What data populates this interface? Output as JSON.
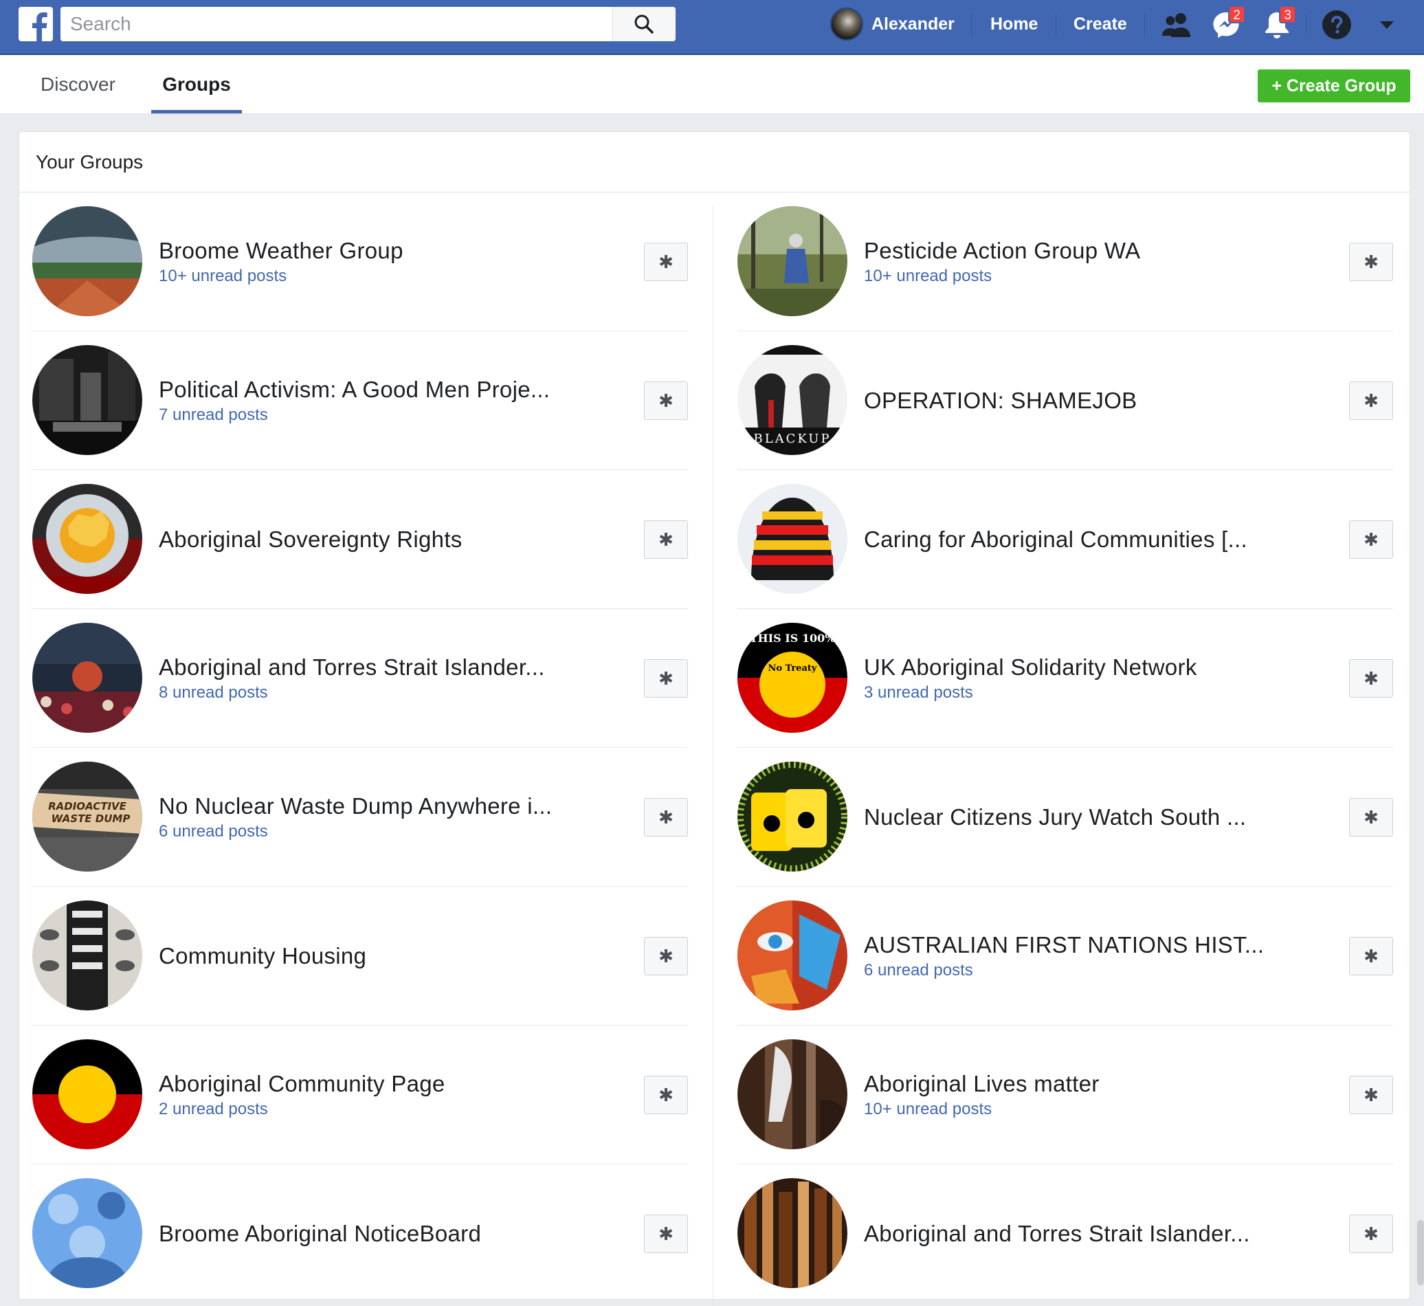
{
  "topbar": {
    "logo_icon": "facebook-f-icon",
    "search": {
      "placeholder": "Search",
      "value": "",
      "icon": "search-icon"
    },
    "profile_name": "Alexander",
    "home_label": "Home",
    "create_label": "Create",
    "friends_icon": "friends-icon",
    "messenger_icon": "messenger-icon",
    "messenger_badge": "2",
    "notifications_icon": "bell-icon",
    "notifications_badge": "3",
    "help_icon": "question-icon",
    "menu_icon": "caret-down-icon",
    "brand_color": "#4267b2",
    "badge_color": "#fa3e3e"
  },
  "subheader": {
    "tabs": [
      {
        "label": "Discover",
        "active": false
      },
      {
        "label": "Groups",
        "active": true
      }
    ],
    "create_group_label": "+ Create Group",
    "create_group_color": "#42b72a"
  },
  "your_groups": {
    "title": "Your Groups",
    "left": [
      {
        "name": "Broome Weather Group",
        "unread": "10+ unread posts"
      },
      {
        "name": "Political Activism: A Good Men Proje...",
        "unread": "7 unread posts"
      },
      {
        "name": "Aboriginal Sovereignty Rights",
        "unread": ""
      },
      {
        "name": "Aboriginal and Torres Strait Islander...",
        "unread": "8 unread posts"
      },
      {
        "name": "No Nuclear Waste Dump Anywhere i...",
        "unread": "6 unread posts"
      },
      {
        "name": "Community Housing",
        "unread": ""
      },
      {
        "name": "Aboriginal Community Page",
        "unread": "2 unread posts"
      },
      {
        "name": "Broome Aboriginal NoticeBoard",
        "unread": ""
      }
    ],
    "right": [
      {
        "name": "Pesticide Action Group WA",
        "unread": "10+ unread posts"
      },
      {
        "name": "OPERATION: SHAMEJOB",
        "unread": ""
      },
      {
        "name": "Caring for Aboriginal Communities [...",
        "unread": ""
      },
      {
        "name": "UK Aboriginal Solidarity Network",
        "unread": "3 unread posts"
      },
      {
        "name": "Nuclear Citizens Jury Watch South ...",
        "unread": ""
      },
      {
        "name": "AUSTRALIAN FIRST NATIONS HIST...",
        "unread": "6 unread posts"
      },
      {
        "name": "Aboriginal Lives matter",
        "unread": "10+ unread posts"
      },
      {
        "name": "Aboriginal and Torres Strait Islander...",
        "unread": ""
      }
    ],
    "settings_icon": "gear-icon",
    "avatar_text": {
      "blackup": "BLACKUP",
      "this_is": "THIS IS 100%",
      "no_treaty": "No Treaty",
      "radioactive": "RADIOACTIVE",
      "waste_dump": "WASTE DUMP"
    }
  }
}
